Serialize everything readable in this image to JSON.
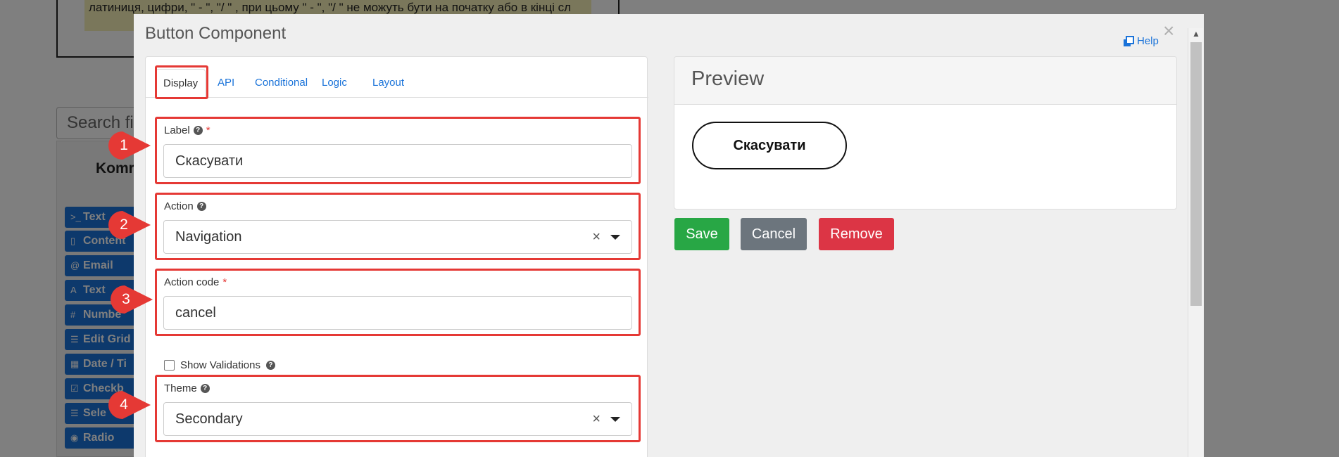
{
  "background": {
    "hint_text": "латиниця, цифри, \" - \", \"/ \" , при цьому  \" - \", \"/ \" не можуть бути на початку або в кінці сл",
    "search_placeholder": "Search fi",
    "panel_title": "Komr",
    "components": [
      {
        "icon": "terminal-icon",
        "glyph": ">_",
        "label": "Text"
      },
      {
        "icon": "html5-icon",
        "glyph": "▯",
        "label": "Content"
      },
      {
        "icon": "at-icon",
        "glyph": "@",
        "label": "Email"
      },
      {
        "icon": "font-icon",
        "glyph": "A",
        "label": "Text"
      },
      {
        "icon": "hash-icon",
        "glyph": "#",
        "label": "Numbe"
      },
      {
        "icon": "grid-icon",
        "glyph": "☰",
        "label": "Edit Grid"
      },
      {
        "icon": "calendar-icon",
        "glyph": "▦",
        "label": "Date / Ti"
      },
      {
        "icon": "check-square-icon",
        "glyph": "☑",
        "label": "Checkb"
      },
      {
        "icon": "list-icon",
        "glyph": "☰",
        "label": "Sele"
      },
      {
        "icon": "dot-circle-icon",
        "glyph": "◉",
        "label": "Radio"
      }
    ]
  },
  "modal": {
    "title": "Button Component",
    "help_label": "Help",
    "close_glyph": "×",
    "tabs": [
      {
        "label": "Display",
        "active": true
      },
      {
        "label": "API",
        "active": false
      },
      {
        "label": "Conditional",
        "active": false
      },
      {
        "label": "Logic",
        "active": false
      },
      {
        "label": "Layout",
        "active": false
      }
    ],
    "fields": {
      "label": {
        "label": "Label",
        "required": "*",
        "value": "Скасувати"
      },
      "action": {
        "label": "Action",
        "value": "Navigation",
        "clear": "×"
      },
      "action_code": {
        "label": "Action code",
        "required": "*",
        "value": "cancel"
      },
      "show_validations": {
        "label": "Show Validations",
        "checked": false
      },
      "theme": {
        "label": "Theme",
        "value": "Secondary",
        "clear": "×"
      }
    },
    "preview": {
      "title": "Preview",
      "button_label": "Скасувати"
    },
    "actions": {
      "save": "Save",
      "cancel": "Cancel",
      "remove": "Remove"
    }
  },
  "markers": [
    "1",
    "2",
    "3",
    "4"
  ],
  "colors": {
    "accent": "#1a73d9",
    "highlight": "#e53935",
    "save": "#28a745",
    "cancel": "#6c757d",
    "remove": "#dc3545"
  }
}
